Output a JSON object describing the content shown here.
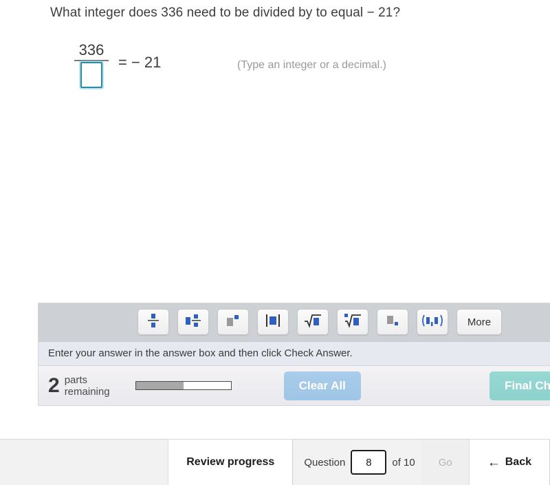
{
  "question": {
    "text": "What integer does 336 need to be divided by to equal  − 21?"
  },
  "equation": {
    "numerator": "336",
    "denominator_value": "",
    "denominator_placeholder": "",
    "right_side": "=  − 21",
    "hint": "(Type an integer or a decimal.)",
    "answer_box_border_color": "#2a8ba8"
  },
  "mathbar": {
    "buttons": [
      {
        "name": "fraction",
        "icon": "fraction-icon",
        "label": ""
      },
      {
        "name": "mixed-number",
        "icon": "mixed-number-icon",
        "label": ""
      },
      {
        "name": "exponent",
        "icon": "exponent-icon",
        "label": ""
      },
      {
        "name": "absolute-value",
        "icon": "absolute-value-icon",
        "label": ""
      },
      {
        "name": "square-root",
        "icon": "square-root-icon",
        "label": ""
      },
      {
        "name": "nth-root",
        "icon": "nth-root-icon",
        "label": ""
      },
      {
        "name": "subscript",
        "icon": "subscript-icon",
        "label": ""
      },
      {
        "name": "interval-notation",
        "icon": "interval-notation-icon",
        "label": ""
      },
      {
        "name": "more",
        "icon": "",
        "label": "More"
      }
    ],
    "background_color": "#cdd0d4"
  },
  "instruction": {
    "text": "Enter your answer in the answer box and then click Check Answer."
  },
  "status": {
    "parts_count": "2",
    "parts_label_line1": "parts",
    "parts_label_line2": "remaining",
    "progress_percent": 50,
    "clear_all_label": "Clear All",
    "final_check_label": "Final Che",
    "clear_all_color": "#a0c8e8",
    "final_check_color": "#8ed4d0"
  },
  "bottom_nav": {
    "review_progress_label": "Review progress",
    "question_prefix": "Question",
    "question_number": "8",
    "question_suffix": "of 10",
    "go_label": "Go",
    "back_label": "Back",
    "back_arrow": "←"
  }
}
